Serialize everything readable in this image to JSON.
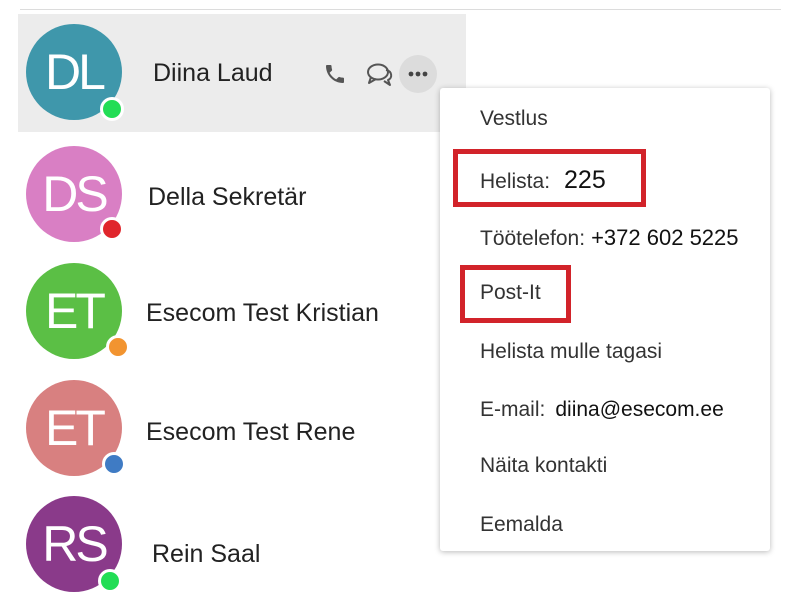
{
  "contacts": [
    {
      "initials": "DL",
      "name": "Diina Laud",
      "avatar_color": "#3f97ab",
      "status_color": "#22dd55",
      "selected": true
    },
    {
      "initials": "DS",
      "name": "Della Sekretär",
      "avatar_color": "#d97fc4",
      "status_color": "#e0262c",
      "selected": false
    },
    {
      "initials": "ET",
      "name": "Esecom Test Kristian",
      "avatar_color": "#5bbf45",
      "status_color": "#f29430",
      "selected": false
    },
    {
      "initials": "ET",
      "name": "Esecom Test Rene",
      "avatar_color": "#d88080",
      "status_color": "#3f7bc4",
      "selected": false
    },
    {
      "initials": "RS",
      "name": "Rein Saal",
      "avatar_color": "#8a3a8a",
      "status_color": "#22dd55",
      "selected": false
    }
  ],
  "row_actions": {
    "icons": [
      "phone-icon",
      "chat-icon",
      "more-icon"
    ]
  },
  "menu": {
    "chat_label": "Vestlus",
    "call_label": "Helista:",
    "call_value": "225",
    "work_phone_label": "Töötelefon:",
    "work_phone_value": "+372 602 5225",
    "postit_label": "Post-It",
    "callback_label": "Helista mulle tagasi",
    "email_label": "E-mail:",
    "email_value": "diina@esecom.ee",
    "show_contact_label": "Näita kontakti",
    "remove_label": "Eemalda"
  },
  "colors": {
    "highlight": "#d2232a",
    "selected_row": "#ececec"
  }
}
